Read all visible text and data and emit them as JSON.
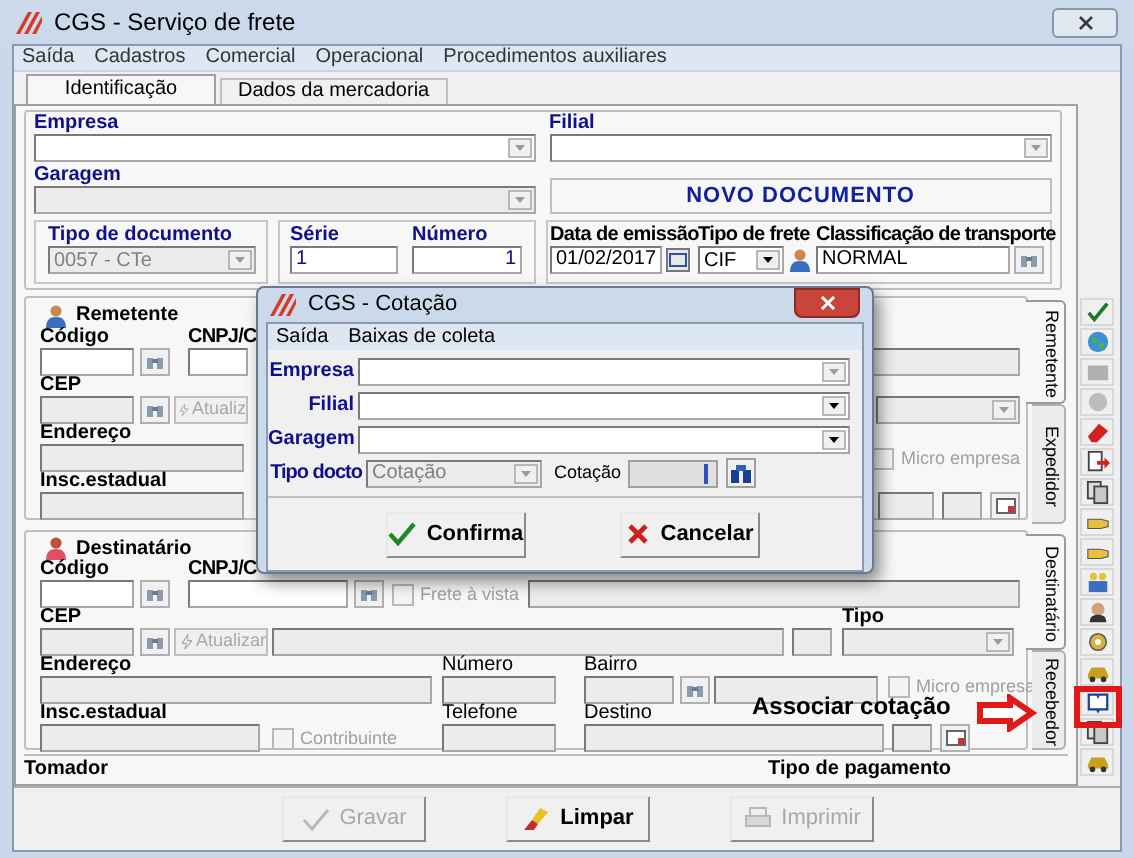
{
  "window": {
    "title": "CGS - Serviço de frete"
  },
  "menu": [
    "Saída",
    "Cadastros",
    "Comercial",
    "Operacional",
    "Procedimentos auxiliares"
  ],
  "tabs": [
    {
      "label": "Identificação",
      "selected": true
    },
    {
      "label": "Dados da mercadoria",
      "selected": false
    }
  ],
  "document": {
    "empresa_label": "Empresa",
    "filial_label": "Filial",
    "garagem_label": "Garagem",
    "status": "NOVO DOCUMENTO",
    "tipo_documento_label": "Tipo de documento",
    "tipo_documento": "0057 - CTe",
    "serie_label": "Série",
    "serie": "1",
    "numero_label": "Número",
    "numero": "1",
    "data_emissao_label": "Data de emissão",
    "data_emissao": "01/02/2017",
    "tipo_frete_label": "Tipo de frete",
    "tipo_frete": "CIF",
    "classificacao_label": "Classificação de transporte",
    "classificacao": "NORMAL"
  },
  "remetente": {
    "title": "Remetente",
    "codigo_label": "Código",
    "cnpj_label": "CNPJ/C",
    "cep_label": "CEP",
    "atualizar": "Atualiz",
    "endereco_label": "Endereço",
    "insc_label": "Insc.estadual",
    "micro_empresa": {
      "label": "Micro empresa",
      "checked": false,
      "disabled": true
    }
  },
  "remetente_tabs": [
    {
      "label": "Remetente",
      "selected": true
    },
    {
      "label": "Expedidor",
      "selected": false
    }
  ],
  "destinatario": {
    "title": "Destinatário",
    "codigo_label": "Código",
    "cnpj_label": "CNPJ/C",
    "frete_a_vista": {
      "label": "Frete à vista",
      "checked": false,
      "disabled": true
    },
    "cep_label": "CEP",
    "atualizar": "Atualizar",
    "tipo_label": "Tipo",
    "endereco_label": "Endereço",
    "numero_label": "Número",
    "bairro_label": "Bairro",
    "micro_empresa": {
      "label": "Micro empresa",
      "checked": false,
      "disabled": true
    },
    "insc_label": "Insc.estadual",
    "contribuinte": {
      "label": "Contribuinte",
      "checked": false,
      "disabled": true
    },
    "telefone_label": "Telefone",
    "destino_label": "Destino"
  },
  "destinatario_tabs": [
    {
      "label": "Destinatário",
      "selected": true
    },
    {
      "label": "Recebedor",
      "selected": false
    }
  ],
  "tomador_label": "Tomador",
  "tipo_pagamento_label": "Tipo de pagamento",
  "buttons": [
    {
      "label": "Gravar",
      "kind": "save",
      "disabled": true
    },
    {
      "label": "Limpar",
      "kind": "clear",
      "disabled": false
    },
    {
      "label": "Imprimir",
      "kind": "print",
      "disabled": true
    }
  ],
  "annotation": {
    "label": "Associar cotação"
  },
  "dialog": {
    "title": "CGS - Cotação",
    "menu": [
      "Saída",
      "Baixas de coleta"
    ],
    "empresa_label": "Empresa",
    "filial_label": "Filial",
    "garagem_label": "Garagem",
    "tipo_docto_label": "Tipo docto",
    "tipo_docto": "Cotação",
    "cotacao_label": "Cotação",
    "buttons": [
      {
        "label": "Confirma",
        "kind": "confirm"
      },
      {
        "label": "Cancelar",
        "kind": "cancel"
      }
    ]
  }
}
